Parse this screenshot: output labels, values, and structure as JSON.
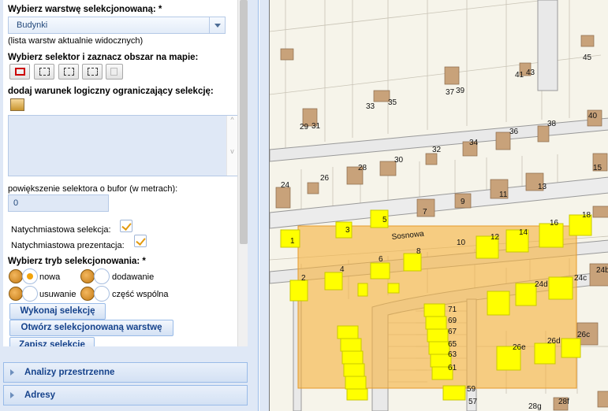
{
  "panel": {
    "layer_label": "Wybierz warstwę selekcjonowaną: *",
    "layer_value": "Budynki",
    "layer_hint": "(lista warstw aktualnie widocznych)",
    "selector_label": "Wybierz selektor i zaznacz obszar na mapie:",
    "condition_label": "dodaj warunek logiczny ograniczający selekcję:",
    "buffer_label": "powiększenie selektora o bufor (w metrach):",
    "buffer_value": "0",
    "instant_selection": "Natychmiastowa selekcja:",
    "instant_presentation": "Natychmiastowa prezentacja:",
    "mode_label": "Wybierz tryb selekcjonowania: *",
    "modes": [
      "nowa",
      "dodawanie",
      "usuwanie",
      "część wspólna"
    ],
    "btn_execute": "Wykonaj selekcję",
    "btn_open_layer": "Otwórz selekcjonowaną warstwę",
    "btn_save": "Zapisz selekcję",
    "accordion": [
      "Analizy przestrzenne",
      "Adresy"
    ]
  },
  "map": {
    "street": "Sosnowa",
    "house_numbers": [
      "45",
      "41",
      "43",
      "37",
      "39",
      "33",
      "35",
      "29",
      "31",
      "40",
      "38",
      "36",
      "34",
      "32",
      "30",
      "28",
      "26",
      "24",
      "15",
      "13",
      "11",
      "9",
      "7",
      "5",
      "3",
      "1",
      "10",
      "12",
      "14",
      "16",
      "18",
      "2",
      "4",
      "6",
      "8",
      "24c",
      "24b",
      "24d",
      "26c",
      "26d",
      "26e",
      "28f",
      "28g",
      "57",
      "59",
      "61",
      "63",
      "65",
      "67",
      "69",
      "71"
    ],
    "colors": {
      "building": "#c8a27a",
      "selected": "#ffff00",
      "selection_area": "#f5b340"
    }
  }
}
